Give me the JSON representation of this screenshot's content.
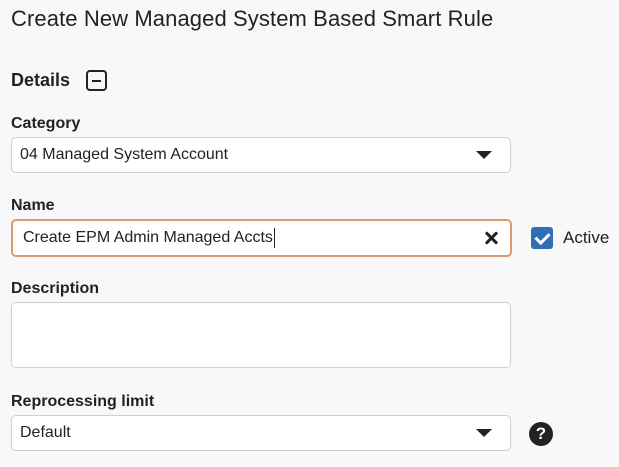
{
  "page": {
    "title": "Create New Managed System Based Smart Rule"
  },
  "details": {
    "section_title": "Details",
    "category": {
      "label": "Category",
      "value": "04 Managed System Account"
    },
    "name": {
      "label": "Name",
      "value": "Create EPM Admin Managed Accts"
    },
    "active": {
      "label": "Active",
      "checked": true
    },
    "description": {
      "label": "Description",
      "value": ""
    },
    "reprocessing_limit": {
      "label": "Reprocessing limit",
      "value": "Default"
    },
    "help_glyph": "?"
  },
  "icons": {
    "collapse": "minus-square-icon",
    "dropdown": "caret-down-icon",
    "clear": "close-icon",
    "check": "checkmark-icon",
    "help": "help-circle-icon"
  },
  "colors": {
    "accent": "#2f6fb5",
    "focus_border": "#d79a73",
    "background": "#f8f8f8"
  }
}
